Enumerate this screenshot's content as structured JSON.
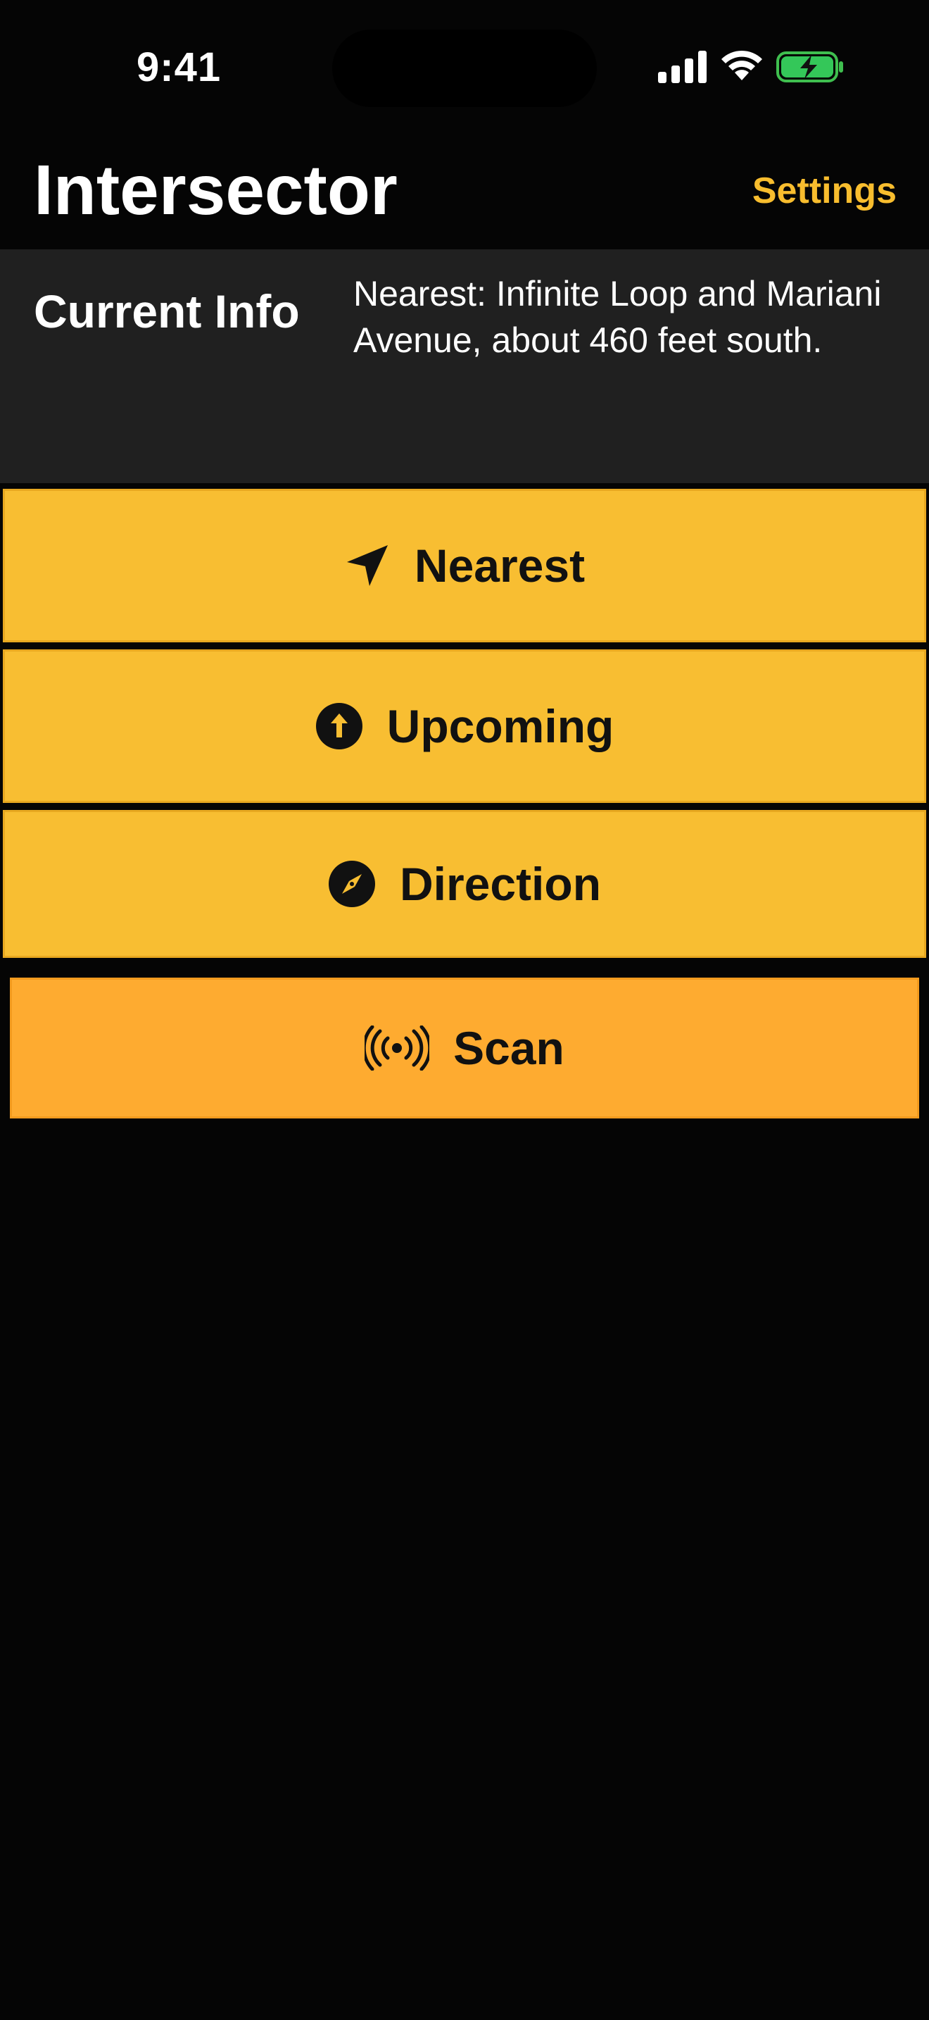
{
  "status_bar": {
    "time": "9:41"
  },
  "nav": {
    "title": "Intersector",
    "settings_label": "Settings"
  },
  "info": {
    "label": "Current Info",
    "text": "Nearest: Infinite Loop and Mariani Avenue, about 460 feet south."
  },
  "actions": {
    "nearest": {
      "label": "Nearest",
      "icon": "location-arrow-icon"
    },
    "upcoming": {
      "label": "Upcoming",
      "icon": "arrow-up-circle-icon"
    },
    "direction": {
      "label": "Direction",
      "icon": "compass-icon"
    },
    "scan": {
      "label": "Scan",
      "icon": "broadcast-icon"
    }
  },
  "colors": {
    "accent": "#f8bd2e",
    "button_yellow": "#f8be32",
    "button_orange": "#feab30",
    "panel": "#202020",
    "background": "#050505"
  }
}
